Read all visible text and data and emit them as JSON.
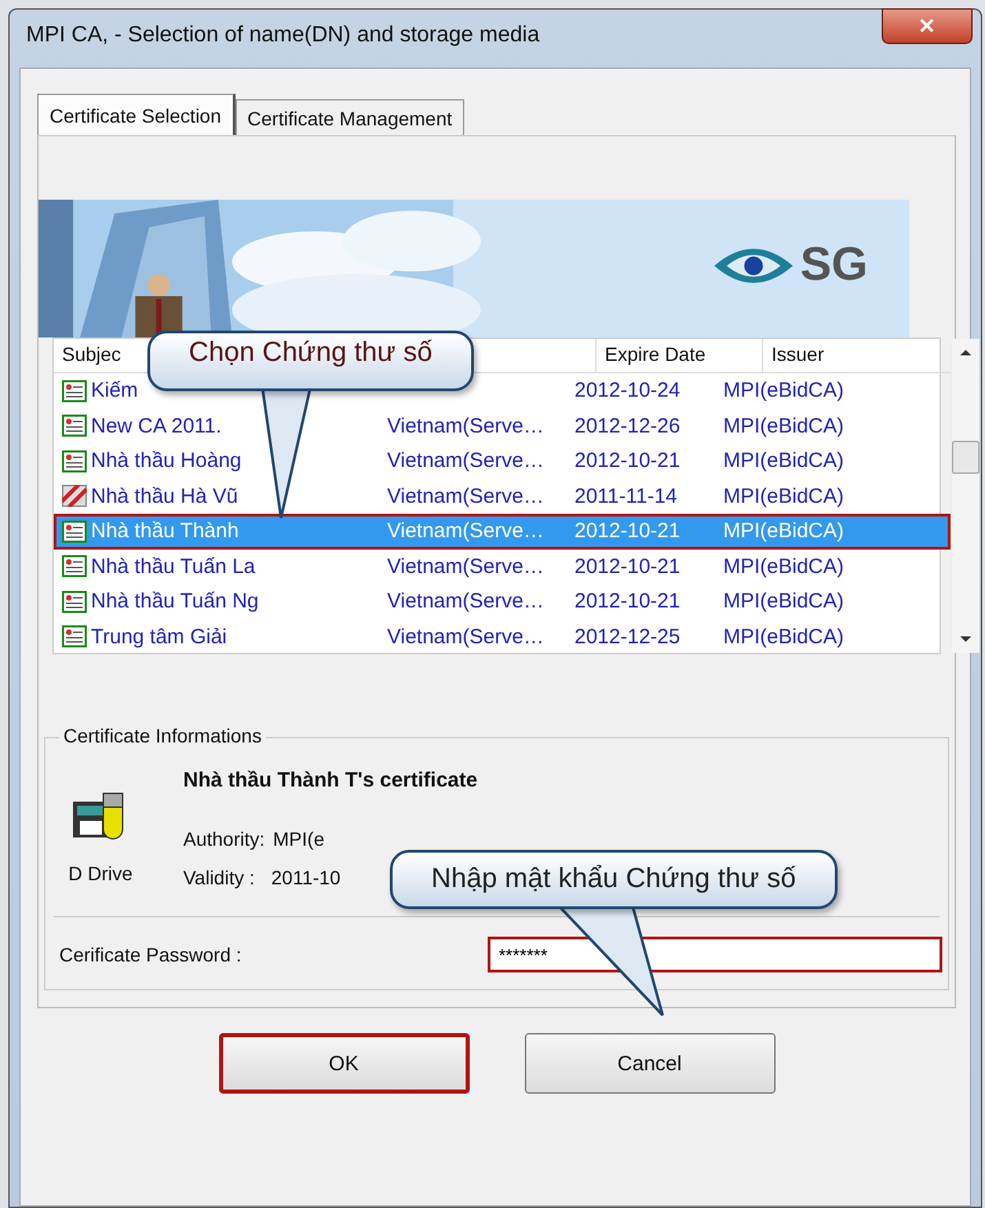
{
  "window": {
    "title": "MPI CA, - Selection of name(DN) and storage media",
    "close": "✕"
  },
  "tabs": [
    {
      "label": "Certificate Selection",
      "selected": true
    },
    {
      "label": "Certificate Management",
      "selected": false
    }
  ],
  "banner": {
    "logo_text": "SG"
  },
  "table": {
    "columns": [
      "Subjec",
      "Expire Date",
      "Issuer"
    ],
    "rows": [
      {
        "kind": "valid",
        "subject": "Kiếm",
        "expire": "2012-10-24",
        "issuer": "MPI(eBidCA)",
        "selected": false,
        "highlighted": false
      },
      {
        "kind": "valid",
        "subject": "New CA 2011.",
        "column_2": "Vietnam(Serve…",
        "expire": "2012-12-26",
        "issuer": "MPI(eBidCA)",
        "selected": false,
        "highlighted": false
      },
      {
        "kind": "valid",
        "subject": "Nhà thầu Hoàng",
        "column_2": "Vietnam(Serve…",
        "expire": "2012-10-21",
        "issuer": "MPI(eBidCA)",
        "selected": false,
        "highlighted": false
      },
      {
        "kind": "revoked",
        "subject": "Nhà thầu Hà Vũ",
        "column_2": "Vietnam(Serve…",
        "expire": "2011-11-14",
        "issuer": "MPI(eBidCA)",
        "selected": false,
        "highlighted": false
      },
      {
        "kind": "valid",
        "subject": "Nhà thầu Thành",
        "column_2": "Vietnam(Serve…",
        "expire": "2012-10-21",
        "issuer": "MPI(eBidCA)",
        "selected": true,
        "highlighted": true
      },
      {
        "kind": "valid",
        "subject": "Nhà thầu Tuấn La",
        "column_2": "Vietnam(Serve…",
        "expire": "2012-10-21",
        "issuer": "MPI(eBidCA)",
        "selected": false,
        "highlighted": false
      },
      {
        "kind": "valid",
        "subject": "Nhà thầu Tuấn Ng",
        "column_2": "Vietnam(Serve…",
        "expire": "2012-10-21",
        "issuer": "MPI(eBidCA)",
        "selected": false,
        "highlighted": false
      },
      {
        "kind": "valid",
        "subject": "Trung tâm Giải",
        "column_2": "Vietnam(Serve…",
        "expire": "2012-12-25",
        "issuer": "MPI(eBidCA)",
        "selected": false,
        "highlighted": false
      }
    ]
  },
  "info": {
    "legend": "Certificate Informations",
    "title": "Nhà thầu Thành T's certificate",
    "drive": "D Drive",
    "authority_label": "Authority:",
    "authority": "MPI(e",
    "validity_label": "Validity :",
    "validity": "2011-10"
  },
  "password": {
    "label": "Cerificate Password :",
    "value": "*******",
    "highlighted": true
  },
  "buttons": [
    {
      "label": "OK",
      "highlighted": true
    },
    {
      "label": "Cancel",
      "highlighted": false
    }
  ],
  "callouts": [
    {
      "text": "Chọn Chứng thư số"
    },
    {
      "text": "Nhập mật khẩu Chứng thư số"
    }
  ]
}
